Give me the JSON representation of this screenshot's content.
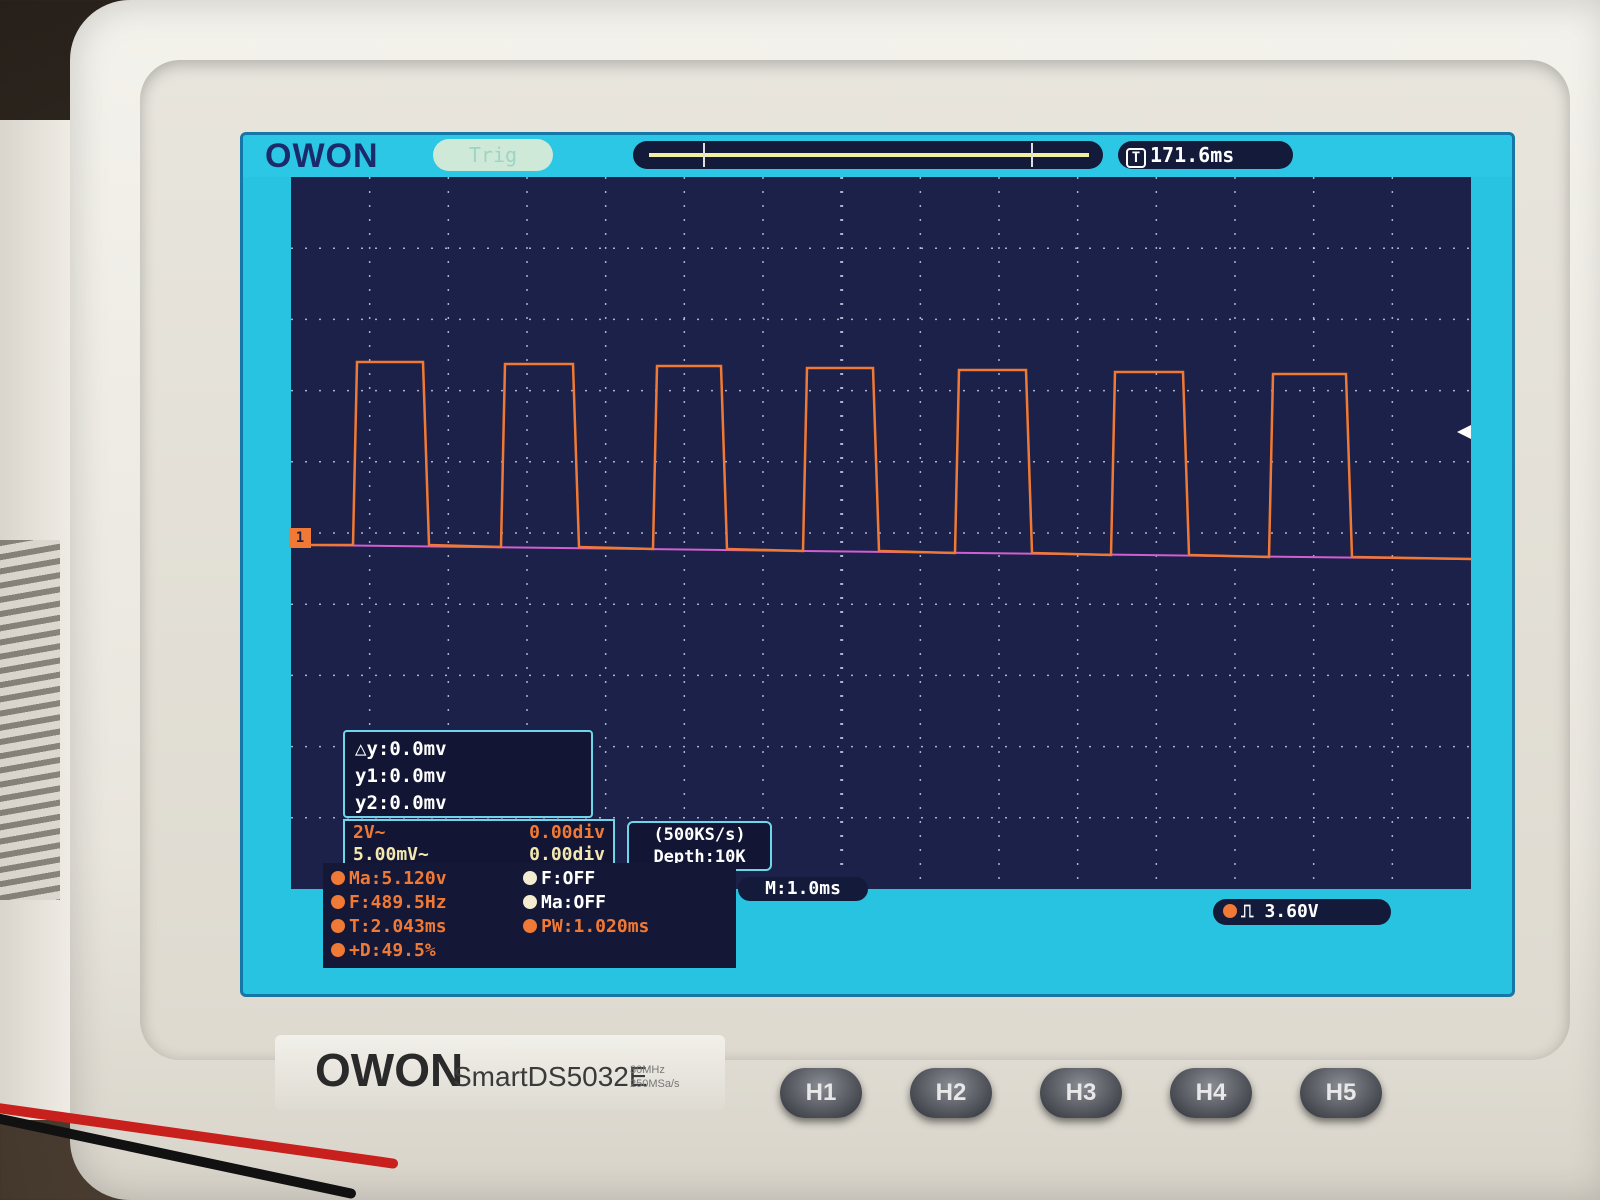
{
  "header": {
    "brand": "OWON",
    "trigger_status": "Trig",
    "trigger_time": "171.6ms",
    "trigger_time_badge": "T"
  },
  "cursor_readout": {
    "delta_y": "△y:0.0mv",
    "y1": "y1:0.0mv",
    "y2": "y2:0.0mv"
  },
  "channels": [
    {
      "scale": "2V~",
      "position": "0.00div",
      "color": "#f07a35"
    },
    {
      "scale": "5.00mV~",
      "position": "0.00div",
      "color": "#f2e7b0"
    }
  ],
  "acquisition": {
    "sample_rate": "(500KS/s)",
    "depth": "Depth:10K"
  },
  "measurements": {
    "left": [
      "Ma:5.120v",
      "F:489.5Hz",
      "T:2.043ms",
      "+D:49.5%"
    ],
    "right": [
      "F:OFF",
      "Ma:OFF",
      "PW:1.020ms"
    ]
  },
  "timebase": "M:1.0ms",
  "trigger_level": "3.60V",
  "channel_marker": "1",
  "model": {
    "brand": "OWON",
    "name": "SmartDS5032E",
    "spec_line1": "30MHz",
    "spec_line2": "250MSa/s"
  },
  "hotkeys": [
    "H1",
    "H2",
    "H3",
    "H4",
    "H5"
  ],
  "colors": {
    "screen": "#27c3e0",
    "plot_bg": "#1b2148",
    "trace": "#f07a35",
    "grid": "#cfd6ee"
  }
}
